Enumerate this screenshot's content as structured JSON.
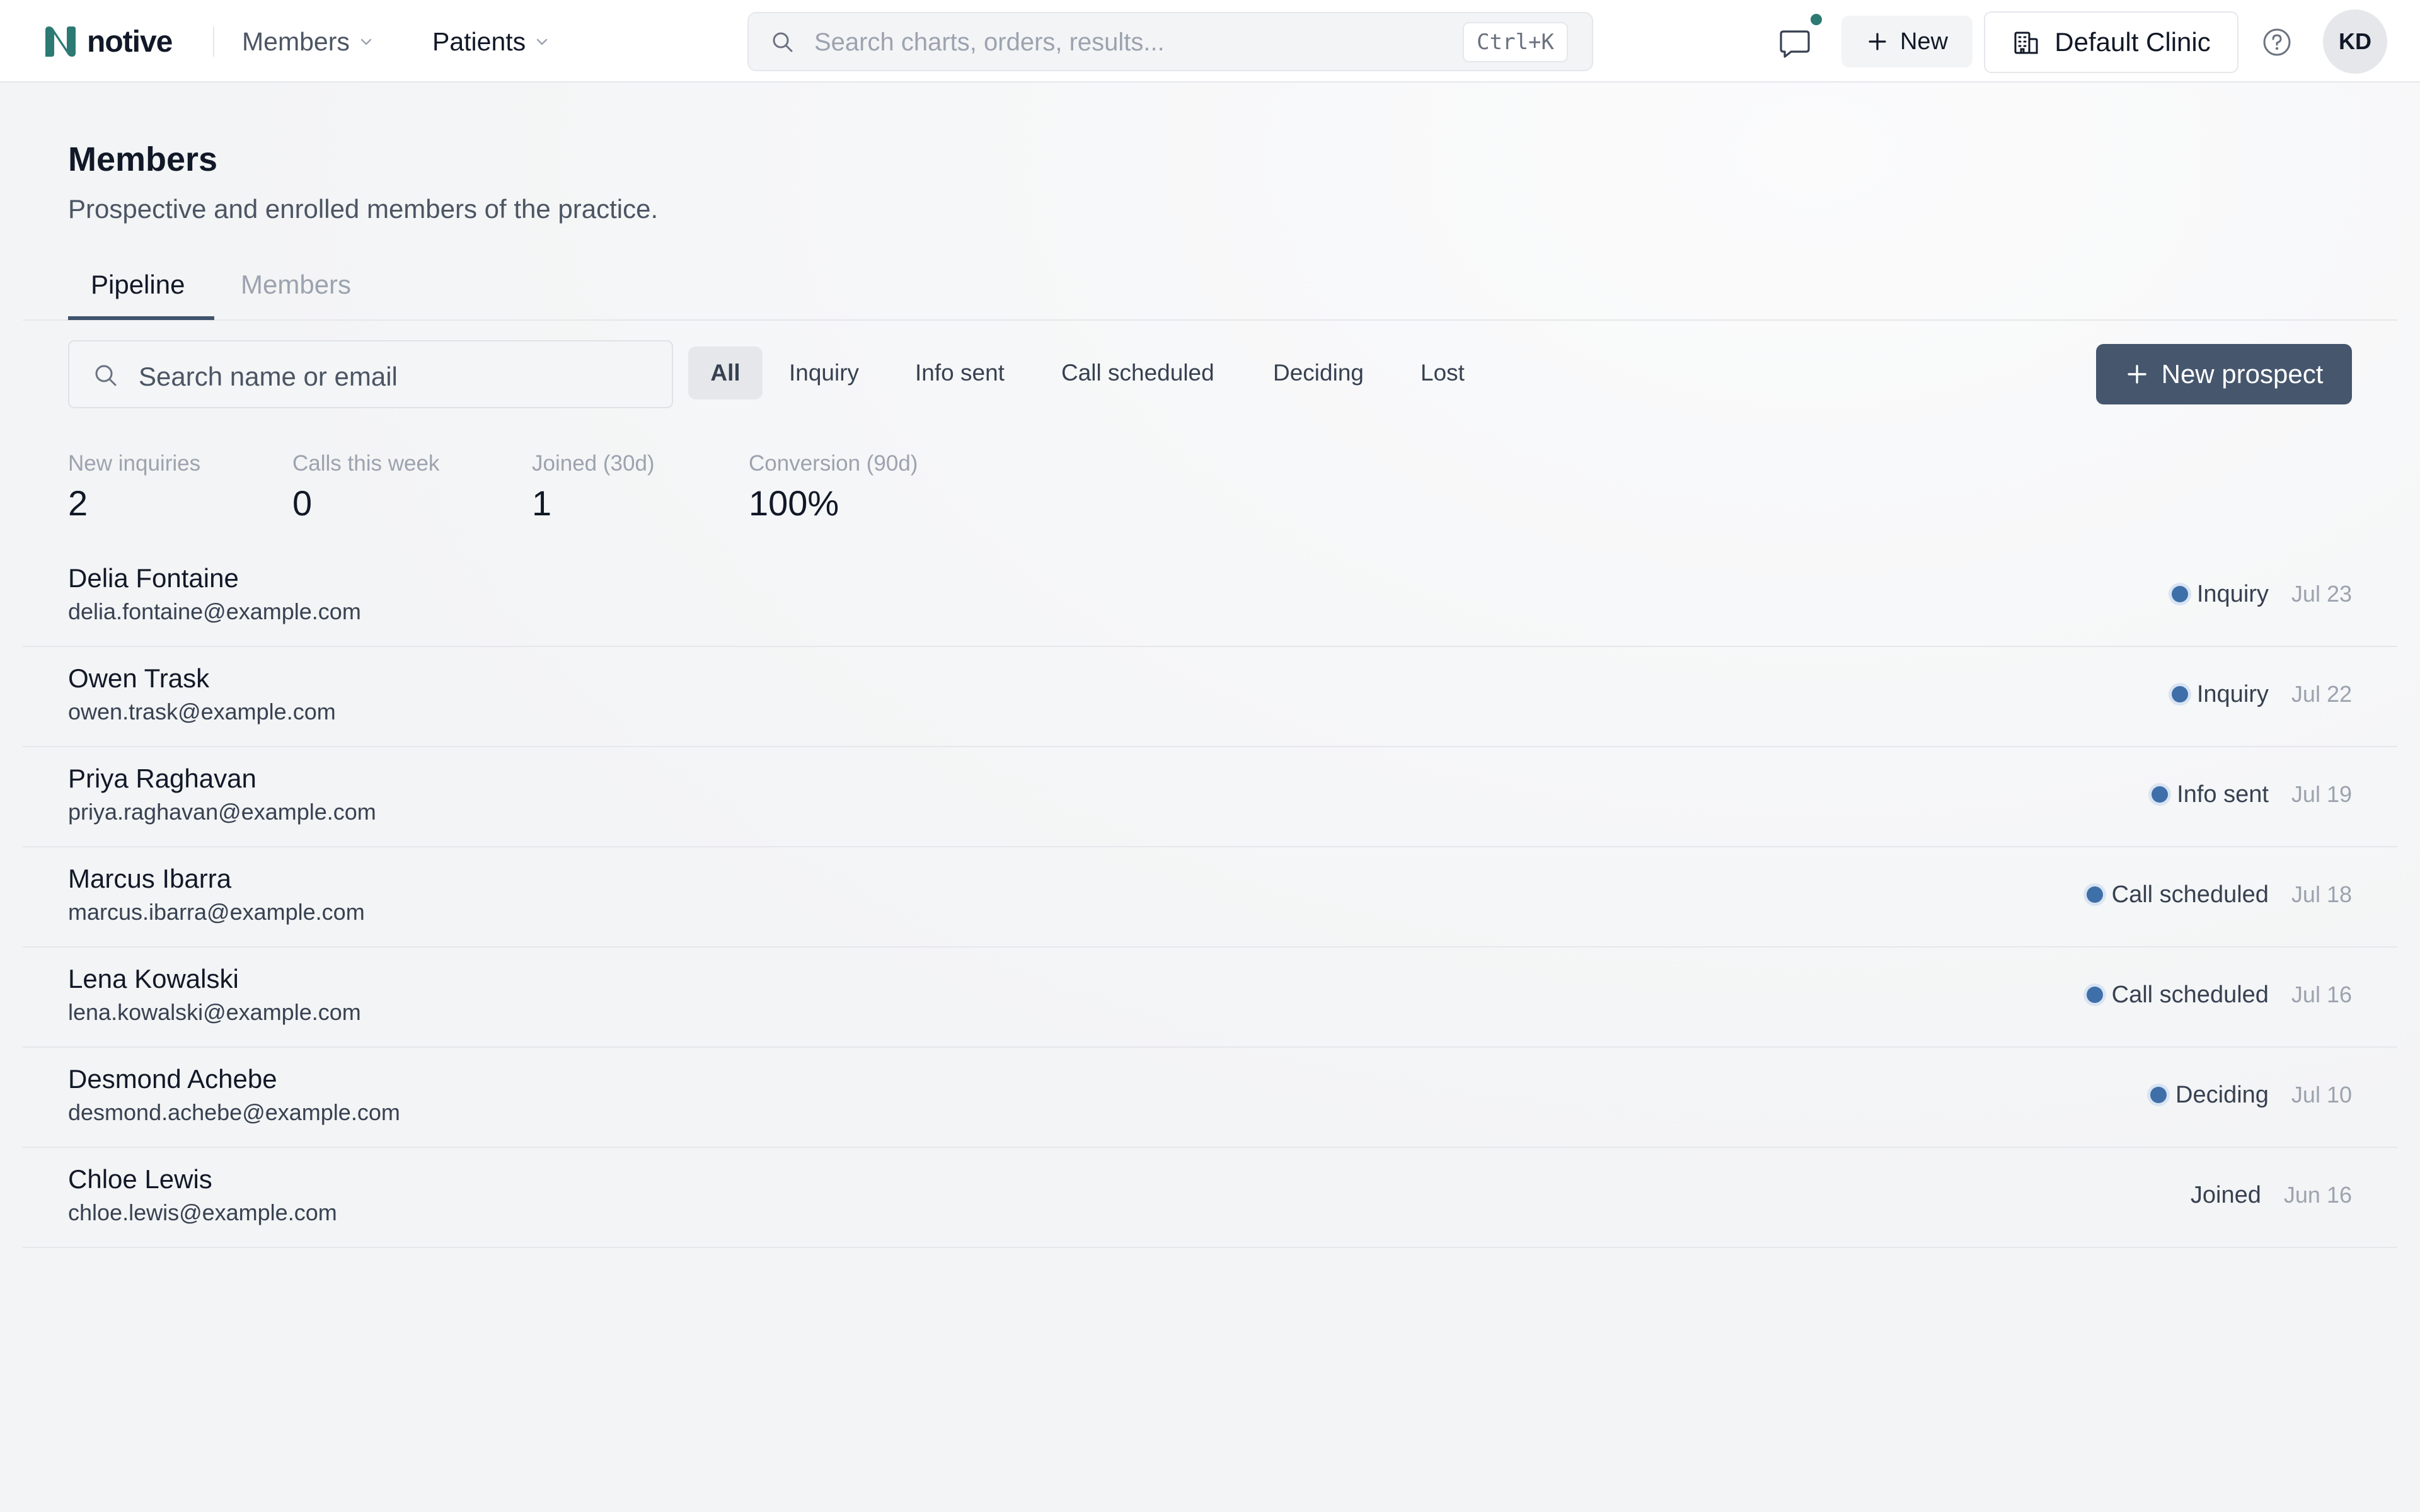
{
  "app": {
    "brand": "notive",
    "nav": [
      {
        "label": "Members"
      },
      {
        "label": "Patients"
      }
    ],
    "search_placeholder": "Search charts, orders, results...",
    "search_shortcut": "Ctrl+K",
    "new_label": "New",
    "clinic_label": "Default Clinic",
    "avatar_initials": "KD",
    "colors": {
      "brand": "#2c7a73",
      "primary_button": "#45566d",
      "status_dot": "#3f6fa8"
    }
  },
  "page": {
    "title": "Members",
    "subtitle": "Prospective and enrolled members of the practice.",
    "tabs": [
      {
        "label": "Pipeline",
        "active": true
      },
      {
        "label": "Members",
        "active": false
      }
    ]
  },
  "toolbar": {
    "search_placeholder": "Search name or email",
    "filters": [
      {
        "label": "All",
        "active": true
      },
      {
        "label": "Inquiry"
      },
      {
        "label": "Info sent"
      },
      {
        "label": "Call scheduled"
      },
      {
        "label": "Deciding"
      },
      {
        "label": "Lost"
      }
    ],
    "new_prospect_label": "New prospect"
  },
  "stats": [
    {
      "label": "New inquiries",
      "value": "2"
    },
    {
      "label": "Calls this week",
      "value": "0"
    },
    {
      "label": "Joined (30d)",
      "value": "1"
    },
    {
      "label": "Conversion (90d)",
      "value": "100%"
    }
  ],
  "prospects": [
    {
      "name": "Delia Fontaine",
      "email": "delia.fontaine@example.com",
      "status": "Inquiry",
      "date": "Jul 23",
      "dot": true
    },
    {
      "name": "Owen Trask",
      "email": "owen.trask@example.com",
      "status": "Inquiry",
      "date": "Jul 22",
      "dot": true
    },
    {
      "name": "Priya Raghavan",
      "email": "priya.raghavan@example.com",
      "status": "Info sent",
      "date": "Jul 19",
      "dot": true
    },
    {
      "name": "Marcus Ibarra",
      "email": "marcus.ibarra@example.com",
      "status": "Call scheduled",
      "date": "Jul 18",
      "dot": true
    },
    {
      "name": "Lena Kowalski",
      "email": "lena.kowalski@example.com",
      "status": "Call scheduled",
      "date": "Jul 16",
      "dot": true
    },
    {
      "name": "Desmond Achebe",
      "email": "desmond.achebe@example.com",
      "status": "Deciding",
      "date": "Jul 10",
      "dot": true
    },
    {
      "name": "Chloe Lewis",
      "email": "chloe.lewis@example.com",
      "status": "Joined",
      "date": "Jun 16",
      "dot": false
    }
  ]
}
